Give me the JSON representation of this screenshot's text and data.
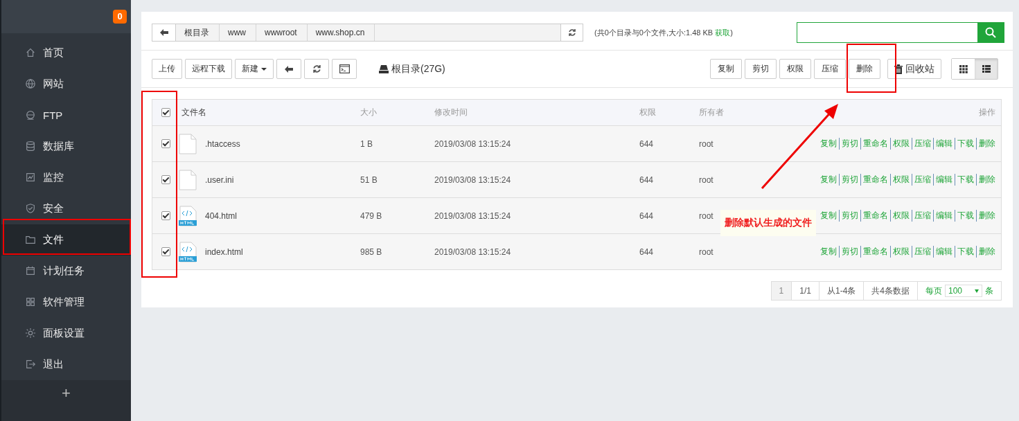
{
  "sidebar": {
    "badge": "0",
    "items": [
      {
        "label": "首页",
        "selected": false
      },
      {
        "label": "网站",
        "selected": false
      },
      {
        "label": "FTP",
        "selected": false
      },
      {
        "label": "数据库",
        "selected": false
      },
      {
        "label": "监控",
        "selected": false
      },
      {
        "label": "安全",
        "selected": false
      },
      {
        "label": "文件",
        "selected": true
      },
      {
        "label": "计划任务",
        "selected": false
      },
      {
        "label": "软件管理",
        "selected": false
      },
      {
        "label": "面板设置",
        "selected": false
      },
      {
        "label": "退出",
        "selected": false
      }
    ],
    "add_button": "+"
  },
  "breadcrumb": [
    "根目录",
    "www",
    "wwwroot",
    "www.shop.cn"
  ],
  "dir_info": {
    "text": "(共0个目录与0个文件,大小:1.48 KB ",
    "link": "获取",
    "close": ")"
  },
  "toolbar_left": [
    {
      "label": "上传"
    },
    {
      "label": "远程下载"
    },
    {
      "label": "新建",
      "kind": "dropdown"
    }
  ],
  "disk_label": "根目录(27G)",
  "toolbar_right": [
    "复制",
    "剪切",
    "权限",
    "压缩",
    "删除"
  ],
  "recycle_button": "回收站",
  "views": [
    {
      "kind": "grid",
      "selected": false
    },
    {
      "kind": "list",
      "selected": true
    }
  ],
  "table": {
    "select_all_checked": true,
    "columns": [
      "文件名",
      "大小",
      "修改时间",
      "权限",
      "所有者",
      "操作"
    ],
    "rows": [
      {
        "checked": true,
        "kind": "blank",
        "name": ".htaccess",
        "size": "1 B",
        "modified": "2019/03/08 13:15:24",
        "perm": "644",
        "owner": "root",
        "actions": [
          "复制",
          "剪切",
          "重命名",
          "权限",
          "压缩",
          "编辑",
          "下载",
          "删除"
        ]
      },
      {
        "checked": true,
        "kind": "blank",
        "name": ".user.ini",
        "size": "51 B",
        "modified": "2019/03/08 13:15:24",
        "perm": "644",
        "owner": "root",
        "actions": [
          "复制",
          "剪切",
          "重命名",
          "权限",
          "压缩",
          "编辑",
          "下载",
          "删除"
        ]
      },
      {
        "checked": true,
        "kind": "html",
        "name": "404.html",
        "size": "479 B",
        "modified": "2019/03/08 13:15:24",
        "perm": "644",
        "owner": "root",
        "actions": [
          "复制",
          "剪切",
          "重命名",
          "权限",
          "压缩",
          "编辑",
          "下载",
          "删除"
        ]
      },
      {
        "checked": true,
        "kind": "html",
        "name": "index.html",
        "size": "985 B",
        "modified": "2019/03/08 13:15:24",
        "perm": "644",
        "owner": "root",
        "actions": [
          "复制",
          "剪切",
          "重命名",
          "权限",
          "压缩",
          "编辑",
          "下载",
          "删除"
        ]
      }
    ]
  },
  "pager": {
    "pages": [
      {
        "label": "1",
        "selected": true
      }
    ],
    "page_info": "1/1",
    "range": "从1-4条",
    "total": "共4条数据",
    "per_page_label": "每页",
    "per_page": "100",
    "per_page_unit": "条"
  },
  "annotation": {
    "callout": "删除默认生成的文件"
  }
}
